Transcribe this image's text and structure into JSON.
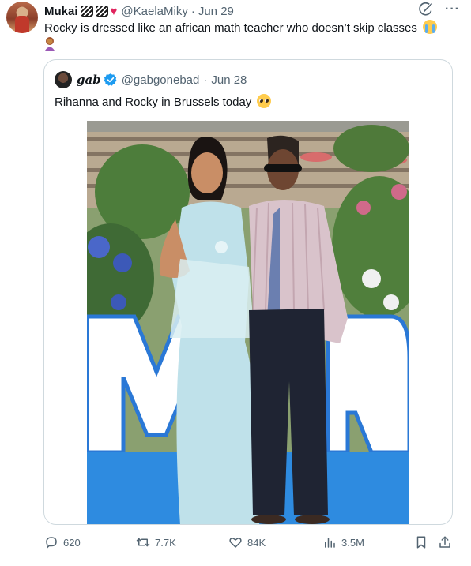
{
  "tweet": {
    "author_name": "Mukai",
    "author_emoji_1": "zebra-icon",
    "author_emoji_2": "zebra-icon",
    "author_emoji_3": "red-heart-icon",
    "handle": "@KaelaMiky",
    "separator": "·",
    "date": "Jun 29",
    "text": "Rocky is dressed like an african math teacher who doesn’t skip classes",
    "text_emoji_1": "loudly-crying-face-icon",
    "text_emoji_2": "person-pouting-icon"
  },
  "quoted": {
    "author_name": "gab",
    "verified_icon": "verified-badge-icon",
    "handle": "@gabgonebad",
    "separator": "·",
    "date": "Jun 28",
    "text": "Rihanna and Rocky in Brussels today",
    "text_emoji": "pleading-face-icon",
    "photo_icon": "photo-icon"
  },
  "actions": {
    "replies": "620",
    "reposts": "7.7K",
    "likes": "84K",
    "views": "3.5M"
  },
  "icons": {
    "grok": "grok-icon",
    "more": "more-icon",
    "reply": "reply-icon",
    "repost": "repost-icon",
    "like": "heart-icon",
    "views": "views-icon",
    "bookmark": "bookmark-icon",
    "share": "share-icon"
  },
  "colors": {
    "text": "#0f1419",
    "secondary": "#536471",
    "border": "#cfd9de",
    "verified": "#1d9bf0",
    "heart_emoji": "#e0245e"
  }
}
